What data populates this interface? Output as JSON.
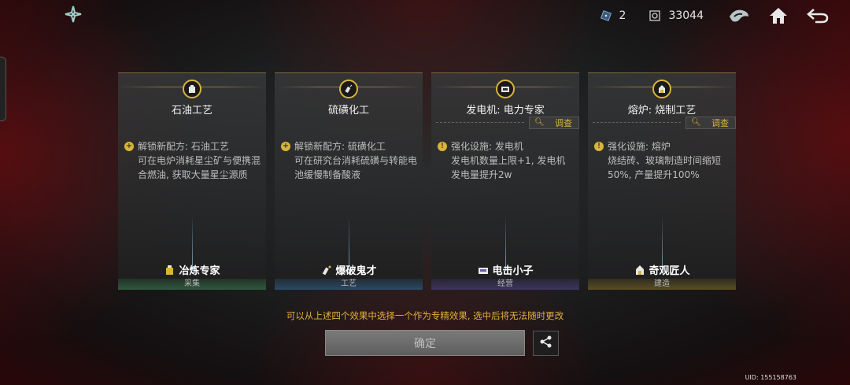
{
  "topbar": {
    "resource1_value": "2",
    "resource2_value": "33044",
    "icons": [
      "app-logo-icon",
      "dice-icon",
      "gear-box-icon",
      "mask-icon",
      "home-icon",
      "back-icon"
    ]
  },
  "cards": [
    {
      "title": "石油工艺",
      "desc_first": "解锁新配方: 石油工艺",
      "desc_rest": "可在电炉消耗星尘矿与便携混合燃油, 获取大量星尘源质",
      "name": "冶炼专家",
      "category": "采集",
      "category_color": "#2f5a3e",
      "has_investigate": false
    },
    {
      "title": "硫磺化工",
      "desc_first": "解锁新配方: 硫磺化工",
      "desc_rest": "可在研究台消耗硫磺与转能电池缓慢制备酸液",
      "name": "爆破鬼才",
      "category": "工艺",
      "category_color": "#2c4a66",
      "has_investigate": false
    },
    {
      "title": "发电机: 电力专家",
      "investigate": "调查",
      "desc_first": "强化设施: 发电机",
      "desc_rest": "发电机数量上限+1, 发电机发电量提升2w",
      "name": "电击小子",
      "category": "经营",
      "category_color": "#3d3560",
      "has_investigate": true
    },
    {
      "title": "熔炉: 烧制工艺",
      "investigate": "调查",
      "desc_first": "强化设施: 熔炉",
      "desc_rest": "烧结砖、玻璃制造时间缩短50%, 产量提升100%",
      "name": "奇观匠人",
      "category": "建造",
      "category_color": "#5a4e22",
      "has_investigate": true
    }
  ],
  "hint": "可以从上述四个效果中选择一个作为专精效果, 选中后将无法随时更改",
  "confirm_label": "确定",
  "uid": "UID: 155158763",
  "accent_color": "#d9b43a"
}
